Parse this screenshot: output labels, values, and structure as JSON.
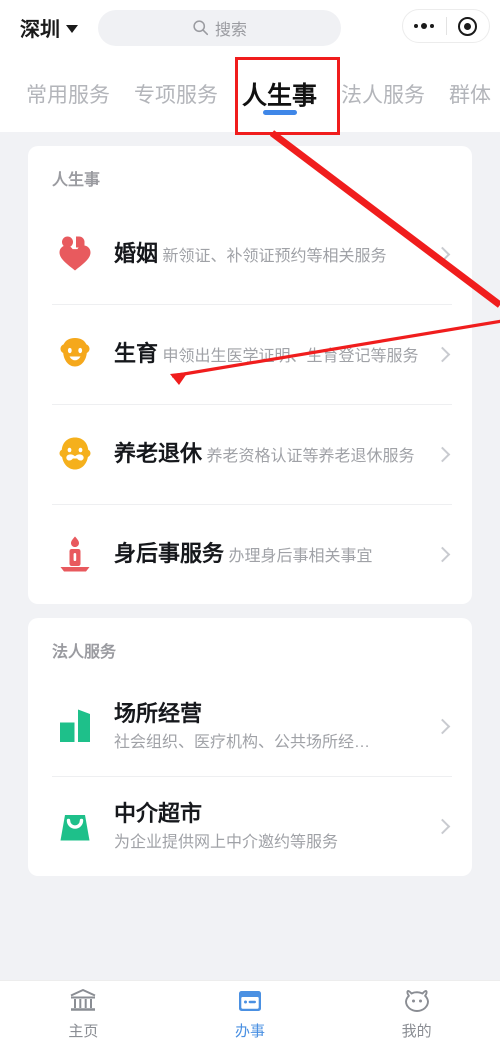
{
  "header": {
    "city": "深圳",
    "city_caret_icon": "chevron-down-icon",
    "search_placeholder": "搜索",
    "search_icon": "search-icon",
    "capsule": {
      "menu_icon": "more-dots-icon",
      "exit_icon": "target-circle-icon"
    }
  },
  "tabs": {
    "items": [
      {
        "label": "常用服务",
        "active": false
      },
      {
        "label": "专项服务",
        "active": false
      },
      {
        "label": "人生事",
        "active": true
      },
      {
        "label": "法人服务",
        "active": false
      },
      {
        "label": "群体",
        "active": false
      }
    ]
  },
  "sections": [
    {
      "title": "人生事",
      "rows": [
        {
          "title": "婚姻",
          "sub": "新领证、补领证预约等相关服务",
          "icon": "couple-heart-icon",
          "color": "#e85a5e"
        },
        {
          "title": "生育",
          "sub": "申领出生医学证明、生育登记等服务",
          "icon": "baby-face-icon",
          "color": "#f5a81c"
        },
        {
          "title": "养老退休",
          "sub": "养老资格认证等养老退休服务",
          "icon": "elder-face-icon",
          "color": "#f5b01c"
        },
        {
          "title": "身后事服务",
          "sub": "办理身后事相关事宜",
          "icon": "candle-icon",
          "color": "#e8595e"
        }
      ]
    },
    {
      "title": "法人服务",
      "rows": [
        {
          "title": "场所经营",
          "sub": "社会组织、医疗机构、公共场所经…",
          "icon": "building-bars-icon",
          "color": "#1ec08a"
        },
        {
          "title": "中介超市",
          "sub": "为企业提供网上中介邀约等服务",
          "icon": "shopping-bag-icon",
          "color": "#1ec08a"
        }
      ]
    }
  ],
  "tabbar": {
    "items": [
      {
        "label": "主页",
        "icon": "government-building-icon",
        "active": false
      },
      {
        "label": "办事",
        "icon": "calendar-card-icon",
        "active": true
      },
      {
        "label": "我的",
        "icon": "user-face-icon",
        "active": false
      }
    ]
  },
  "annotation": {
    "highlight_color": "#f01d1d",
    "highlight_target": "人生事",
    "arrow_target": "生育"
  },
  "colors": {
    "accent": "#4a90e2",
    "tab_underline": "#3f87e8",
    "page_background": "#f1f2f5",
    "card_background": "#ffffff"
  }
}
